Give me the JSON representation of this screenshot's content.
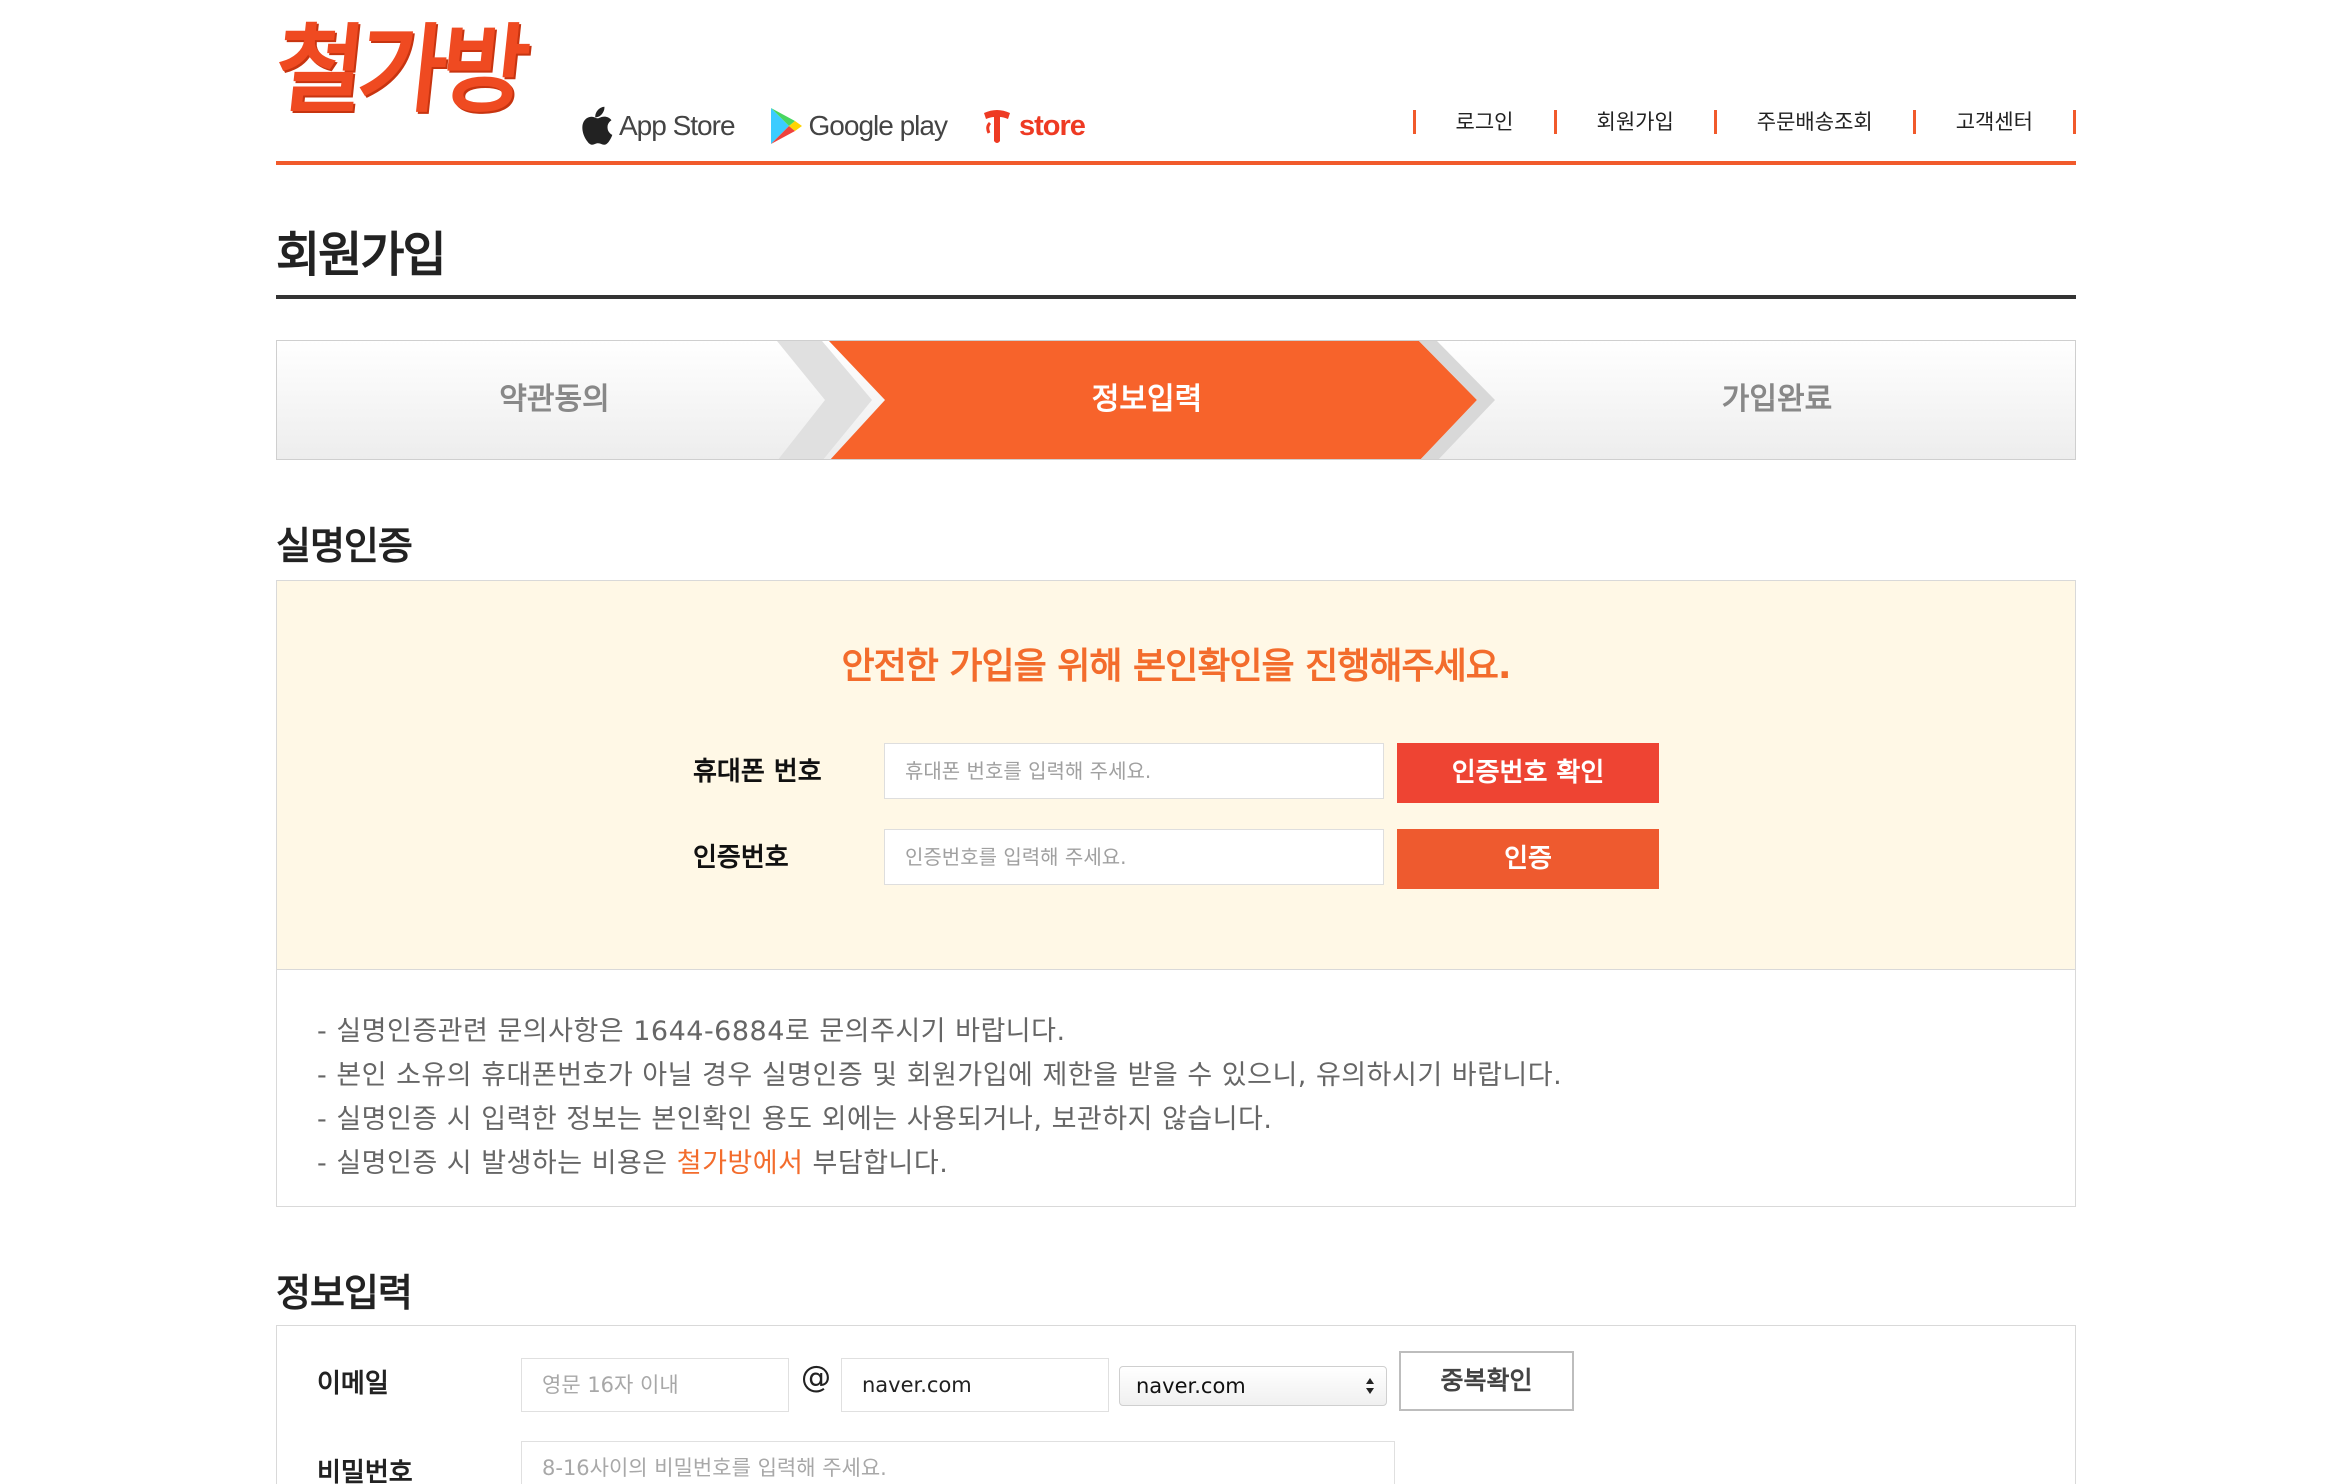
{
  "brand": {
    "logo_text": "철가방",
    "logo_color": "#ef4a21",
    "accent_color": "#f15a2b"
  },
  "stores": [
    {
      "name": "App Store",
      "icon": "apple-icon"
    },
    {
      "name": "Google play",
      "icon": "google-play-icon"
    },
    {
      "name": "store",
      "icon": "tstore-icon"
    }
  ],
  "topnav": [
    "로그인",
    "회원가입",
    "주문배송조회",
    "고객센터"
  ],
  "page": {
    "title": "회원가입"
  },
  "steps": [
    {
      "label": "약관동의",
      "active": false
    },
    {
      "label": "정보입력",
      "active": true
    },
    {
      "label": "가입완료",
      "active": false
    }
  ],
  "verify": {
    "section_title": "실명인증",
    "headline": "안전한 가입을 위해 본인확인을 진행해주세요.",
    "phone_label": "휴대폰 번호",
    "phone_placeholder": "휴대폰 번호를 입력해 주세요.",
    "phone_button": "인증번호 확인",
    "code_label": "인증번호",
    "code_placeholder": "인증번호를 입력해 주세요.",
    "code_button": "인증",
    "notes": [
      {
        "prefix": "- 실명인증관련 문의사항은 1644-6884로 문의주시기 바랍니다.",
        "highlight": "",
        "suffix": ""
      },
      {
        "prefix": "- 본인 소유의 휴대폰번호가 아닐 경우 실명인증 및 회원가입에 제한을 받을 수 있으니, 유의하시기 바랍니다.",
        "highlight": "",
        "suffix": ""
      },
      {
        "prefix": "- 실명인증 시 입력한 정보는 본인확인 용도 외에는 사용되거나, 보관하지 않습니다.",
        "highlight": "",
        "suffix": ""
      },
      {
        "prefix": "- 실명인증 시 발생하는 비용은 ",
        "highlight": "철가방에서",
        "suffix": " 부담합니다."
      }
    ]
  },
  "info": {
    "section_title": "정보입력",
    "email_label": "이메일",
    "email_id_placeholder": "영문 16자 이내",
    "at": "@",
    "email_domain_value": "naver.com",
    "email_domain_select": "naver.com",
    "dup_check_button": "중복확인",
    "password_label": "비밀번호",
    "password_placeholder": "8-16사이의 비밀번호를 입력해 주세요."
  },
  "colors": {
    "step_active": "#f7632b",
    "button_red": "#ee4433",
    "button_orange": "#ee5a2f",
    "verify_bg": "#fff8e6",
    "highlight_text": "#f36c2c"
  }
}
